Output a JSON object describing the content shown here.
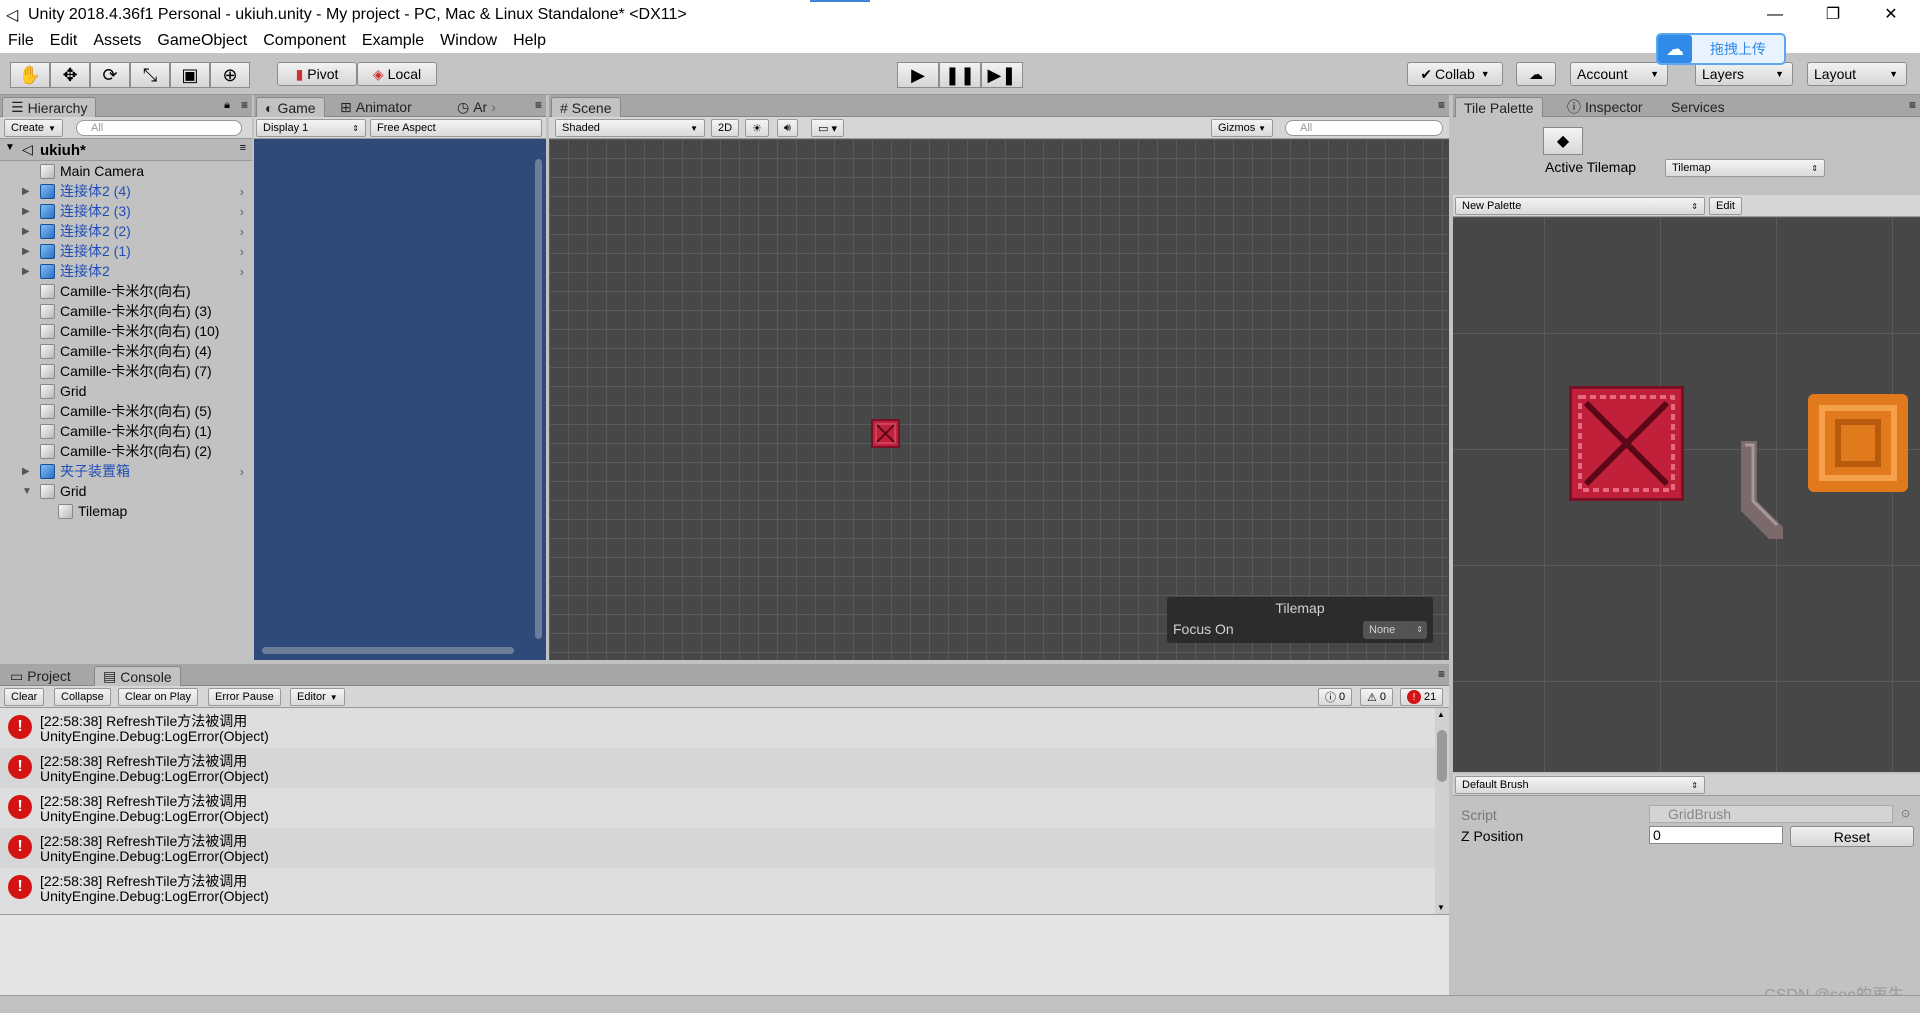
{
  "window": {
    "title": "Unity 2018.4.36f1 Personal - ukiuh.unity - My project - PC, Mac & Linux Standalone* <DX11>",
    "minimize": "—",
    "maximize": "❐",
    "close": "✕"
  },
  "menu": [
    "File",
    "Edit",
    "Assets",
    "GameObject",
    "Component",
    "Example",
    "Window",
    "Help"
  ],
  "toolbar": {
    "pivot": "Pivot",
    "local": "Local",
    "collab": "Collab",
    "account": "Account",
    "layers": "Layers",
    "layout": "Layout",
    "upload_badge": "拖拽上传"
  },
  "hierarchy": {
    "tab": "Hierarchy",
    "create": "Create",
    "search_placeholder": "All",
    "scene": "ukiuh*",
    "items": [
      {
        "label": "Main Camera",
        "icon": "grey",
        "arrow": "",
        "indent": 0,
        "blue": false,
        "chev": false
      },
      {
        "label": "连接体2 (4)",
        "icon": "blue",
        "arrow": "▶",
        "indent": 0,
        "blue": true,
        "chev": true
      },
      {
        "label": "连接体2 (3)",
        "icon": "blue",
        "arrow": "▶",
        "indent": 0,
        "blue": true,
        "chev": true
      },
      {
        "label": "连接体2 (2)",
        "icon": "blue",
        "arrow": "▶",
        "indent": 0,
        "blue": true,
        "chev": true
      },
      {
        "label": "连接体2 (1)",
        "icon": "blue",
        "arrow": "▶",
        "indent": 0,
        "blue": true,
        "chev": true
      },
      {
        "label": "连接体2",
        "icon": "blue",
        "arrow": "▶",
        "indent": 0,
        "blue": true,
        "chev": true
      },
      {
        "label": "Camille-卡米尔(向右)",
        "icon": "grey",
        "arrow": "",
        "indent": 0,
        "blue": false,
        "chev": false
      },
      {
        "label": "Camille-卡米尔(向右) (3)",
        "icon": "grey",
        "arrow": "",
        "indent": 0,
        "blue": false,
        "chev": false
      },
      {
        "label": "Camille-卡米尔(向右) (10)",
        "icon": "grey",
        "arrow": "",
        "indent": 0,
        "blue": false,
        "chev": false
      },
      {
        "label": "Camille-卡米尔(向右) (4)",
        "icon": "grey",
        "arrow": "",
        "indent": 0,
        "blue": false,
        "chev": false
      },
      {
        "label": "Camille-卡米尔(向右) (7)",
        "icon": "grey",
        "arrow": "",
        "indent": 0,
        "blue": false,
        "chev": false
      },
      {
        "label": "Grid",
        "icon": "grey",
        "arrow": "",
        "indent": 0,
        "blue": false,
        "chev": false
      },
      {
        "label": "Camille-卡米尔(向右) (5)",
        "icon": "grey",
        "arrow": "",
        "indent": 0,
        "blue": false,
        "chev": false
      },
      {
        "label": "Camille-卡米尔(向右) (1)",
        "icon": "grey",
        "arrow": "",
        "indent": 0,
        "blue": false,
        "chev": false
      },
      {
        "label": "Camille-卡米尔(向右) (2)",
        "icon": "grey",
        "arrow": "",
        "indent": 0,
        "blue": false,
        "chev": false
      },
      {
        "label": "夹子装置箱",
        "icon": "blue",
        "arrow": "▶",
        "indent": 0,
        "blue": true,
        "chev": true
      },
      {
        "label": "Grid",
        "icon": "grey",
        "arrow": "▼",
        "indent": 0,
        "blue": false,
        "chev": false
      },
      {
        "label": "Tilemap",
        "icon": "grey",
        "arrow": "",
        "indent": 1,
        "blue": false,
        "chev": false
      }
    ]
  },
  "game": {
    "tab_game": "Game",
    "tab_animator": "Animator",
    "tab_ar": "Ar",
    "display": "Display 1",
    "aspect": "Free Aspect"
  },
  "scene": {
    "tab": "Scene",
    "shaded": "Shaded",
    "mode2d": "2D",
    "gizmos": "Gizmos",
    "search_placeholder": "All",
    "overlay_title": "Tilemap",
    "focus_label": "Focus On",
    "focus_value": "None"
  },
  "tile_palette": {
    "tab": "Tile Palette",
    "tab_inspector": "Inspector",
    "tab_services": "Services",
    "active_tilemap_label": "Active Tilemap",
    "active_tilemap_value": "Tilemap",
    "palette": "New Palette",
    "edit": "Edit",
    "brush": "Default Brush",
    "script_label": "Script",
    "script_value": "GridBrush",
    "zpos_label": "Z Position",
    "zpos_value": "0",
    "reset": "Reset"
  },
  "console": {
    "tab_project": "Project",
    "tab_console": "Console",
    "clear": "Clear",
    "collapse": "Collapse",
    "clear_on_play": "Clear on Play",
    "error_pause": "Error Pause",
    "editor": "Editor",
    "info_count": "0",
    "warn_count": "0",
    "error_count": "21",
    "entries": [
      {
        "line1": "[22:58:38] RefreshTile方法被调用",
        "line2": "UnityEngine.Debug:LogError(Object)"
      },
      {
        "line1": "[22:58:38] RefreshTile方法被调用",
        "line2": "UnityEngine.Debug:LogError(Object)"
      },
      {
        "line1": "[22:58:38] RefreshTile方法被调用",
        "line2": "UnityEngine.Debug:LogError(Object)"
      },
      {
        "line1": "[22:58:38] RefreshTile方法被调用",
        "line2": "UnityEngine.Debug:LogError(Object)"
      },
      {
        "line1": "[22:58:38] RefreshTile方法被调用",
        "line2": "UnityEngine.Debug:LogError(Object)"
      }
    ]
  },
  "watermark": "CSDN @see的再生",
  "colors": {
    "game_bg": "#2e4a78",
    "error_red": "#d41414",
    "tile_red": "#c0203a",
    "tile_orange": "#e07a1c"
  }
}
